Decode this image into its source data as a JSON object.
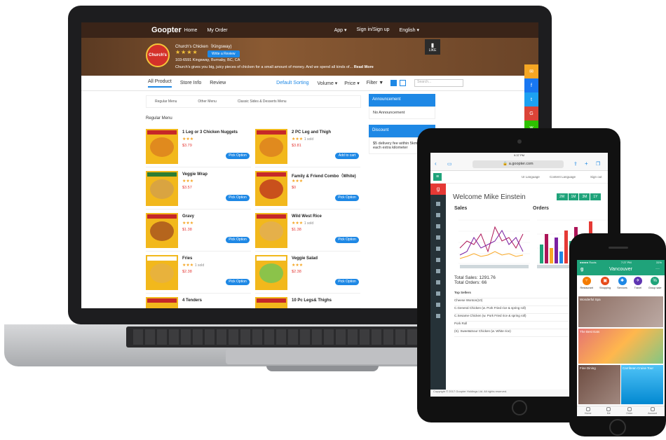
{
  "laptop": {
    "nav": {
      "logo": "Goopter",
      "home": "Home",
      "my_order": "My Order",
      "app": "App ▾",
      "sign_in": "Sign in/Sign up",
      "language": "English ▾"
    },
    "store": {
      "logo_text": "Church's",
      "name": "Church's Chicken（Kingsway)",
      "stars": "★★★★",
      "write_review": "Write a Review",
      "address": "103-6591 Kingsway, Burnaby, BC, CA",
      "description": "Church's gives you big, juicy pieces of chicken for a small amount of money. And we spend all kinds of...",
      "read_more": "Read More",
      "like": "LIKE"
    },
    "tabs": {
      "all_product": "All Product",
      "store_info": "Store Info",
      "review": "Review"
    },
    "toolbar": {
      "default_sorting": "Default Sorting",
      "volume": "Volume ▾",
      "price": "Price ▾",
      "filter": "Filter ▼",
      "search_placeholder": "Search..."
    },
    "categories": [
      "Regular Menu",
      "Other Menu",
      "Classic Sides & Desserts Menu"
    ],
    "section_title": "Regular Menu",
    "products": [
      {
        "name": "1 Leg or 3 Chicken Nuggets",
        "stars": "★★★",
        "sold": "",
        "price": "$3.79",
        "button": "Pick Option"
      },
      {
        "name": "2 PC Leg and Thigh",
        "stars": "★★★",
        "sold": "1 sold",
        "price": "$3.81",
        "button": "Add to cart"
      },
      {
        "name": "Veggie Wrap",
        "stars": "★★★",
        "sold": "",
        "price": "$3.57",
        "button": "Pick Option"
      },
      {
        "name": "Family & Friend Combo（White)",
        "stars": "★★★",
        "sold": "",
        "price": "$0",
        "button": "Pick Option"
      },
      {
        "name": "Gravy",
        "stars": "★★★",
        "sold": "",
        "price": "$1.38",
        "button": "Pick Option"
      },
      {
        "name": "Wild West Rice",
        "stars": "★★★",
        "sold": "1 sold",
        "price": "$1.38",
        "button": "Pick Option"
      },
      {
        "name": "Fries",
        "stars": "★★★",
        "sold": "1 sold",
        "price": "$2.38",
        "button": "Pick Option"
      },
      {
        "name": "Veggie Salad",
        "stars": "★★★",
        "sold": "",
        "price": "$2.38",
        "button": "Pick Option"
      },
      {
        "name": "4 Tenders",
        "stars": "",
        "sold": "",
        "price": "",
        "button": ""
      },
      {
        "name": "10 Pc Legs& Thighs",
        "stars": "",
        "sold": "",
        "price": "",
        "button": ""
      }
    ],
    "announcement": {
      "title": "Announcement",
      "body": "No Announcement"
    },
    "discount": {
      "title": "Discount",
      "body": "$5 delivery fee within 5km, $1 each extra kilometer"
    }
  },
  "tablet": {
    "time": "9:37 PM",
    "url": "a.goopter.com",
    "topbar_links": [
      "UI Language",
      "Content Language",
      "Sign out"
    ],
    "welcome": "Welcome Mike Einstein",
    "ranges": [
      "2W",
      "1M",
      "3M",
      "1Y"
    ],
    "sales_title": "Sales",
    "orders_title": "Orders",
    "total_sales": "Total Sales: 1291.76",
    "total_orders": "Total Orders: 66",
    "top_sellers_header": "Top Sellers",
    "price_header": "Price",
    "top_sellers": [
      {
        "name": "Cheese Wonton(10)",
        "price": "$4.9"
      },
      {
        "name": "C.General Chicken (w. Pork Fried rice & spring roll)",
        "price": "$6.9"
      },
      {
        "name": "C.Sesame Chicken (w. Pork Fried rice & spring roll)",
        "price": "$5.7"
      },
      {
        "name": "Pork Roll",
        "price": "$1.1"
      },
      {
        "name": "(S). Sweet&Sour Chicken (w. White rice)",
        "price": "$8.1"
      }
    ],
    "footer": "Copyright © 2017 Goopter Holdings Ltd. All rights reserved."
  },
  "phone": {
    "carrier": "●●●●● Roots",
    "time": "7:27 PM",
    "battery": "31%",
    "city": "Vancouver",
    "categories": [
      "Restaurant",
      "Shopping",
      "Services",
      "Travel",
      "Group sale"
    ],
    "tiles": [
      "Wonderful Spa",
      "The Best Eats",
      "Fine Dining",
      "Carribean Cruise Tour"
    ],
    "tabbar": [
      "Home",
      "Me",
      "Order",
      "Account"
    ]
  }
}
